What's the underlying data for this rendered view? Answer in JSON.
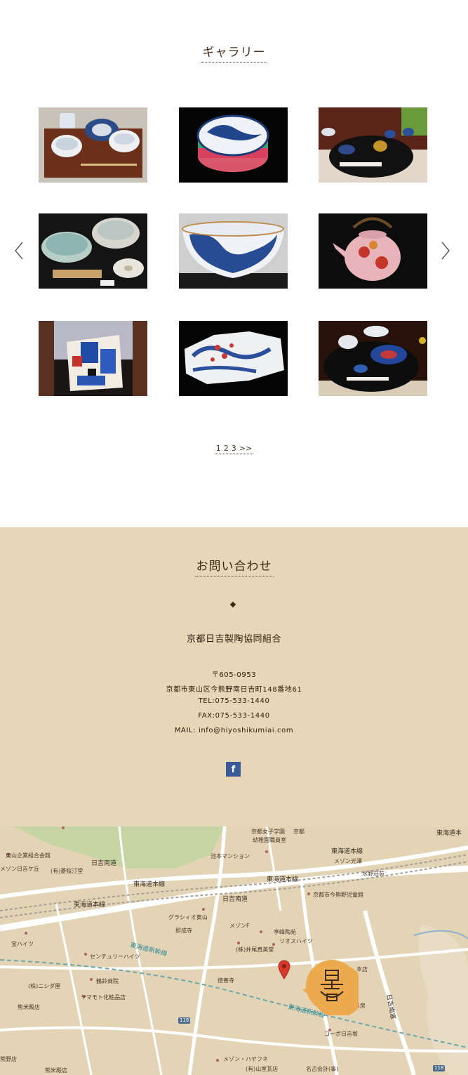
{
  "gallery": {
    "title": "ギャラリー",
    "prev_icon": "chevron-left-icon",
    "next_icon": "chevron-right-icon",
    "pagination": {
      "pages": [
        "1",
        "2",
        "3"
      ],
      "next": ">>"
    }
  },
  "contact": {
    "title": "お問い合わせ",
    "organization": "京都日吉製陶協同組合",
    "postal": "〒605-0953",
    "address": "京都市東山区今熊野南日吉町148番地61",
    "tel": "TEL:075-533-1440",
    "fax": "FAX:075-533-1440",
    "mail": "MAIL: info@hiyoshikumiai.com",
    "facebook_icon": "f"
  },
  "map": {
    "labels": {
      "higashiyama_kigyo": "東山企業組合会館",
      "maison_hiyoshigaoka": "メゾン日吉ケ丘",
      "hishizakura": "(有)菱桜汀堂",
      "hiyoshi_minamimichi": "日吉南道",
      "tokaido_line_1": "東海道本線",
      "tokaido_line_2": "東海道本線",
      "tokaido_line_3": "東海道本線",
      "tokaido_line_4": "東海道本",
      "tokaido_line_5": "東海道本線",
      "kyoto_joshi": "京都女子学園",
      "kyoto_right": "京都",
      "kindergarten": "幼稚園職員室",
      "ikemoto": "池本マンション",
      "maison_mitsuzawa": "メゾン光澤",
      "mizuno": "水野荘苑",
      "hiyoshi_minamimichi_2": "日吉南道",
      "jido_kan": "京都市今熊野児童館",
      "gracio": "グラシィオ東山",
      "sokujoji": "即成寺",
      "maison_f": "メゾンF",
      "rihoen": "李峰陶苑",
      "riohaitsu": "リオスハイツ",
      "inoo": "(株)井尾真美堂",
      "takaramichi": "宝ハイツ",
      "century": "センチュリーハイツ",
      "wakasu": "鶴鈴商院",
      "tokuzenji": "徳善寺",
      "honten": "本店",
      "nikkou": "(株)ニシダ屋",
      "yamamoto": "ヤマモト化粧品店",
      "kumai": "熊米殿店",
      "shinkansen": "東海道新幹線",
      "shinkansen_2": "東海道新幹線",
      "hiyoshi_right": "日吉南道",
      "kobo": "工房",
      "copo": "コーポ日吉坂",
      "kumanoshu": "熊野店",
      "kumai2": "熊米殿店",
      "maison_hayafune": "メゾン・ハヤフネ",
      "yamamuro": "(有)山室瓦店",
      "nakokai": "名古会計(事)",
      "route_118": "118",
      "route_118b": "118"
    },
    "marker_icon": "map-pin-icon",
    "logo_label": "日吉"
  }
}
